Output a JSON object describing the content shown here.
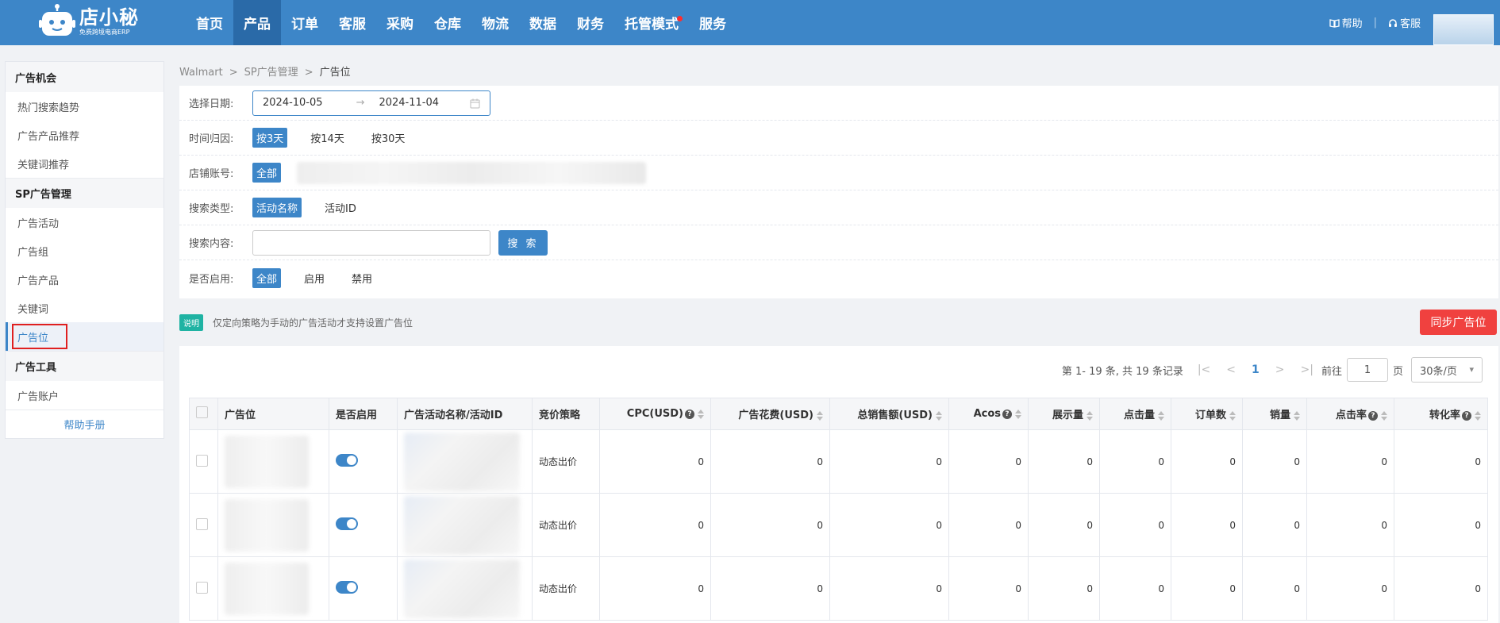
{
  "brand": {
    "name": "店小秘",
    "tagline": "免费跨境电商ERP"
  },
  "nav": [
    {
      "label": "首页",
      "active": false
    },
    {
      "label": "产品",
      "active": true
    },
    {
      "label": "订单",
      "active": false
    },
    {
      "label": "客服",
      "active": false
    },
    {
      "label": "采购",
      "active": false
    },
    {
      "label": "仓库",
      "active": false
    },
    {
      "label": "物流",
      "active": false
    },
    {
      "label": "数据",
      "active": false
    },
    {
      "label": "财务",
      "active": false
    },
    {
      "label": "托管模式",
      "active": false,
      "dot": true
    },
    {
      "label": "服务",
      "active": false
    }
  ],
  "top_right": {
    "help": "帮助",
    "service": "客服"
  },
  "sidebar": {
    "groups": [
      {
        "title": "广告机会",
        "items": [
          "热门搜索趋势",
          "广告产品推荐",
          "关键词推荐"
        ]
      },
      {
        "title": "SP广告管理",
        "items": [
          "广告活动",
          "广告组",
          "广告产品",
          "关键词",
          "广告位"
        ]
      },
      {
        "title": "广告工具",
        "items": [
          "广告账户"
        ]
      }
    ],
    "active_item": "广告位",
    "help_link": "帮助手册"
  },
  "breadcrumb": [
    "Walmart",
    "SP广告管理",
    "广告位"
  ],
  "filters": {
    "date_label": "选择日期:",
    "date_start": "2024-10-05",
    "date_end": "2024-11-04",
    "attribution_label": "时间归因:",
    "attribution_options": [
      "按3天",
      "按14天",
      "按30天"
    ],
    "store_label": "店铺账号:",
    "store_options": [
      "全部"
    ],
    "search_type_label": "搜索类型:",
    "search_type_options": [
      "活动名称",
      "活动ID"
    ],
    "search_content_label": "搜索内容:",
    "search_button": "搜 索",
    "enabled_label": "是否启用:",
    "enabled_options": [
      "全部",
      "启用",
      "禁用"
    ]
  },
  "note": {
    "badge": "说明",
    "text": "仅定向策略为手动的广告活动才支持设置广告位"
  },
  "sync_button": "同步广告位",
  "pager": {
    "summary": "第 1- 19 条, 共 19 条记录",
    "current_page": "1",
    "goto_label": "前往",
    "goto_value": "1",
    "page_unit": "页",
    "page_size": "30条/页"
  },
  "table": {
    "headers": [
      "广告位",
      "是否启用",
      "广告活动名称/活动ID",
      "竞价策略",
      "CPC(USD)",
      "广告花费(USD)",
      "总销售额(USD)",
      "Acos",
      "展示量",
      "点击量",
      "订单数",
      "销量",
      "点击率",
      "转化率"
    ],
    "rows": [
      {
        "strategy": "动态出价",
        "enabled": true,
        "values": [
          "0",
          "0",
          "0",
          "0",
          "0",
          "0",
          "0",
          "0",
          "0",
          "0"
        ]
      },
      {
        "strategy": "动态出价",
        "enabled": true,
        "values": [
          "0",
          "0",
          "0",
          "0",
          "0",
          "0",
          "0",
          "0",
          "0",
          "0"
        ]
      },
      {
        "strategy": "动态出价",
        "enabled": true,
        "values": [
          "0",
          "0",
          "0",
          "0",
          "0",
          "0",
          "0",
          "0",
          "0",
          "0"
        ]
      }
    ]
  },
  "colors": {
    "primary": "#3d86c8",
    "danger": "#f0413f",
    "teal": "#1fb3a3"
  }
}
